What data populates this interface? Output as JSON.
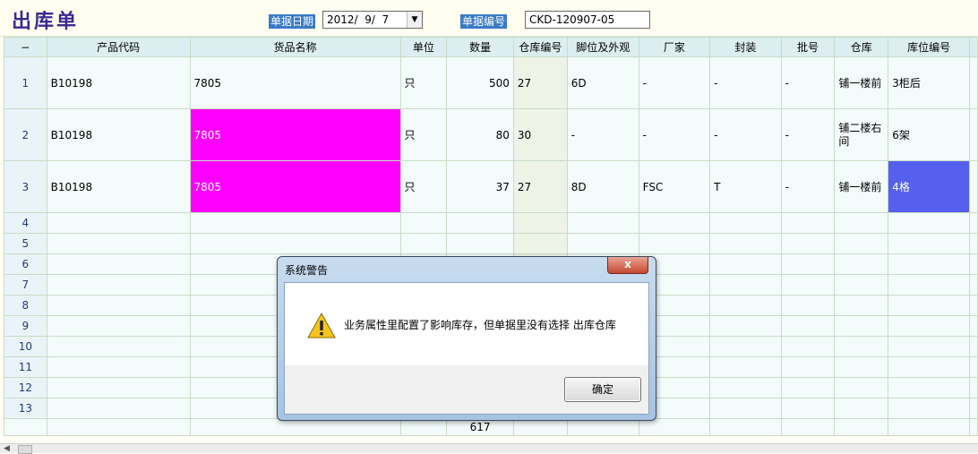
{
  "header": {
    "title": "出库单",
    "date_label": "单据日期",
    "date_value": "2012/  9/  7",
    "code_label": "单据编号",
    "code_value": "CKD-120907-05"
  },
  "table": {
    "corner": "−",
    "columns": [
      "产品代码",
      "货品名称",
      "单位",
      "数量",
      "仓库编号",
      "脚位及外观",
      "厂家",
      "封装",
      "批号",
      "仓库",
      "库位编号"
    ],
    "rows": [
      {
        "no": "1",
        "code": "B10198",
        "name": "7805",
        "unit": "只",
        "qty": "500",
        "wh_no": "27",
        "foot": "6D",
        "maker": "-",
        "pack": "-",
        "batch": "-",
        "warehouse": "铺一楼前",
        "location": "3柜后"
      },
      {
        "no": "2",
        "code": "B10198",
        "name": "7805",
        "unit": "只",
        "qty": "80",
        "wh_no": "30",
        "foot": "-",
        "maker": "-",
        "pack": "-",
        "batch": "-",
        "warehouse": "铺二楼右间",
        "location": "6架"
      },
      {
        "no": "3",
        "code": "B10198",
        "name": "7805",
        "unit": "只",
        "qty": "37",
        "wh_no": "27",
        "foot": "8D",
        "maker": "FSC",
        "pack": "T",
        "batch": "-",
        "warehouse": "铺一楼前",
        "location": "4格"
      }
    ],
    "empty_rows": [
      "4",
      "5",
      "6",
      "7",
      "8",
      "9",
      "10",
      "11",
      "12",
      "13"
    ],
    "total_qty": "617"
  },
  "dialog": {
    "title": "系统警告",
    "close_glyph": "x",
    "icon": "warning-icon",
    "message": "业务属性里配置了影响库存，但单据里没有选择 出库仓库",
    "ok_label": "确定"
  },
  "colors": {
    "highlight_magenta": "#ff00ff",
    "selected_cell": "#5560ee",
    "title_text": "#3b2a90",
    "label_bg": "#3a7ac8"
  }
}
